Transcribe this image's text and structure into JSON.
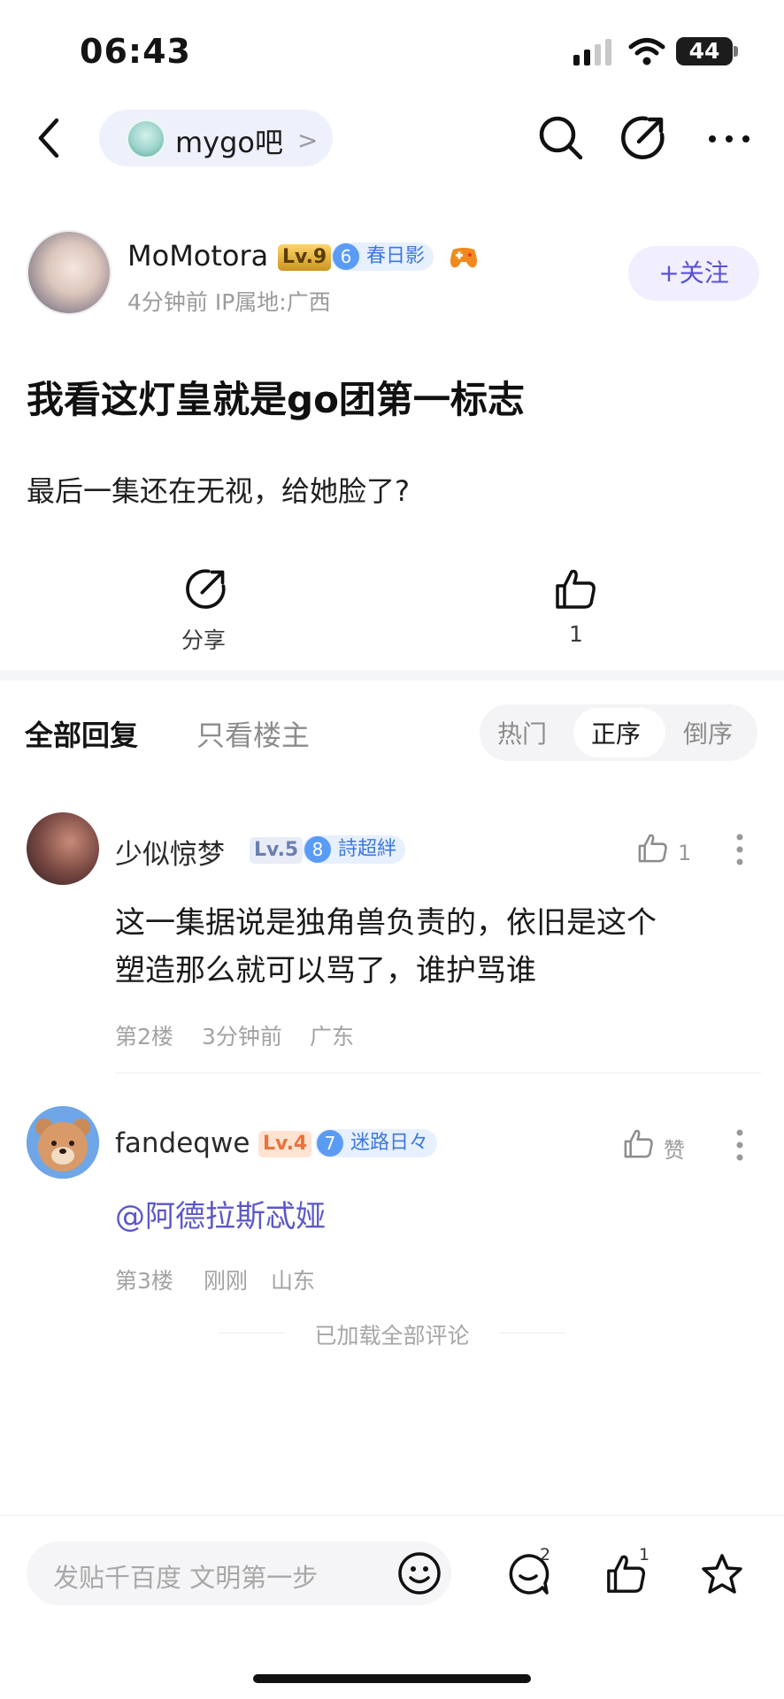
{
  "status_bar": {
    "time": "06:43",
    "battery": "44"
  },
  "nav": {
    "forum_name": "mygo吧",
    "forum_arrow": ">"
  },
  "post": {
    "author": {
      "name": "MoMotora",
      "level": "Lv.9",
      "tag_num": "6",
      "tag_label": "春日影",
      "meta": "4分钟前  IP属地:广西",
      "follow": "+关注"
    },
    "title": "我看这灯皇就是go团第一标志",
    "body": "最后一集还在无视，给她脸了?",
    "share_label": "分享",
    "like_count": "1"
  },
  "tabs": {
    "all": "全部回复",
    "op_only": "只看楼主",
    "sort": [
      "热门",
      "正序",
      "倒序"
    ],
    "sort_active": "正序"
  },
  "comments": [
    {
      "name": "少似惊梦",
      "level": "Lv.5",
      "tag_num": "8",
      "tag_label": "詩超絆",
      "like": "1",
      "text_line1": "这一集据说是独角兽负责的，依旧是这个",
      "text_line2": "塑造那么就可以骂了，谁护骂谁",
      "floor": "第2楼",
      "time": "3分钟前",
      "location": "广东"
    },
    {
      "name": "fandeqwe",
      "level": "Lv.4",
      "tag_num": "7",
      "tag_label": "迷路日々",
      "like": "赞",
      "text": "@阿德拉斯忒娅",
      "floor": "第3楼",
      "time": "刚刚",
      "location": "山东"
    }
  ],
  "loaded_all": "已加载全部评论",
  "bottom_bar": {
    "input_placeholder": "发贴千百度 文明第一步",
    "comment_count": "2",
    "like_count": "1"
  },
  "colors": {
    "accent": "#5b52d6",
    "tag_blue": "#3e79d9",
    "mention": "#5b57c9"
  }
}
